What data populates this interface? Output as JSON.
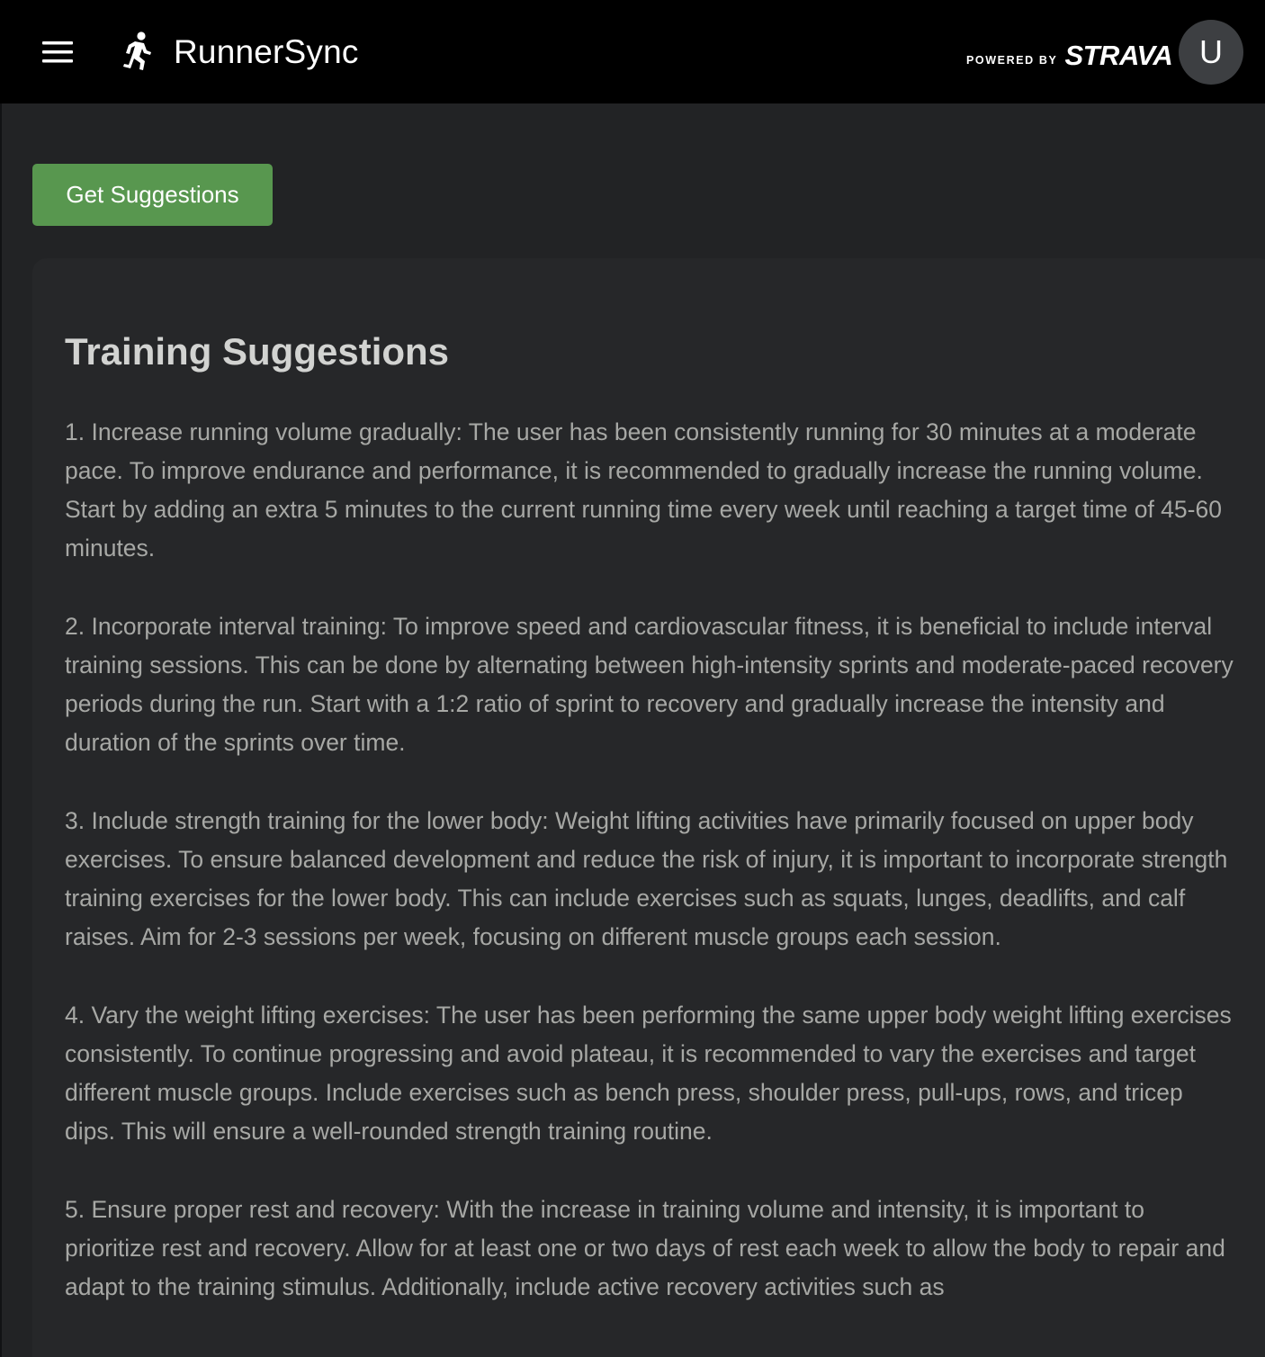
{
  "header": {
    "app_name": "RunnerSync",
    "powered_by": "POWERED BY",
    "partner": "STRAVA",
    "avatar_initial": "U",
    "menu_icon": "hamburger-menu-icon",
    "logo_icon": "runner-icon"
  },
  "actions": {
    "get_suggestions_label": "Get Suggestions"
  },
  "suggestions_panel": {
    "title": "Training Suggestions",
    "items": [
      "1. Increase running volume gradually: The user has been consistently running for 30 minutes at a moderate pace. To improve endurance and performance, it is recommended to gradually increase the running volume. Start by adding an extra 5 minutes to the current running time every week until reaching a target time of 45-60 minutes.",
      "2. Incorporate interval training: To improve speed and cardiovascular fitness, it is beneficial to include interval training sessions. This can be done by alternating between high-intensity sprints and moderate-paced recovery periods during the run. Start with a 1:2 ratio of sprint to recovery and gradually increase the intensity and duration of the sprints over time.",
      "3. Include strength training for the lower body: Weight lifting activities have primarily focused on upper body exercises. To ensure balanced development and reduce the risk of injury, it is important to incorporate strength training exercises for the lower body. This can include exercises such as squats, lunges, deadlifts, and calf raises. Aim for 2-3 sessions per week, focusing on different muscle groups each session.",
      "4. Vary the weight lifting exercises: The user has been performing the same upper body weight lifting exercises consistently. To continue progressing and avoid plateau, it is recommended to vary the exercises and target different muscle groups. Include exercises such as bench press, shoulder press, pull-ups, rows, and tricep dips. This will ensure a well-rounded strength training routine.",
      "5. Ensure proper rest and recovery: With the increase in training volume and intensity, it is important to prioritize rest and recovery. Allow for at least one or two days of rest each week to allow the body to repair and adapt to the training stimulus. Additionally, include active recovery activities such as"
    ]
  },
  "colors": {
    "appbar_bg": "#000000",
    "page_bg": "#222325",
    "card_bg": "#262729",
    "button_green": "#58974f",
    "avatar_bg": "#3d3f42",
    "title_text": "#d2d3d1",
    "body_text": "#a7a8a5"
  }
}
